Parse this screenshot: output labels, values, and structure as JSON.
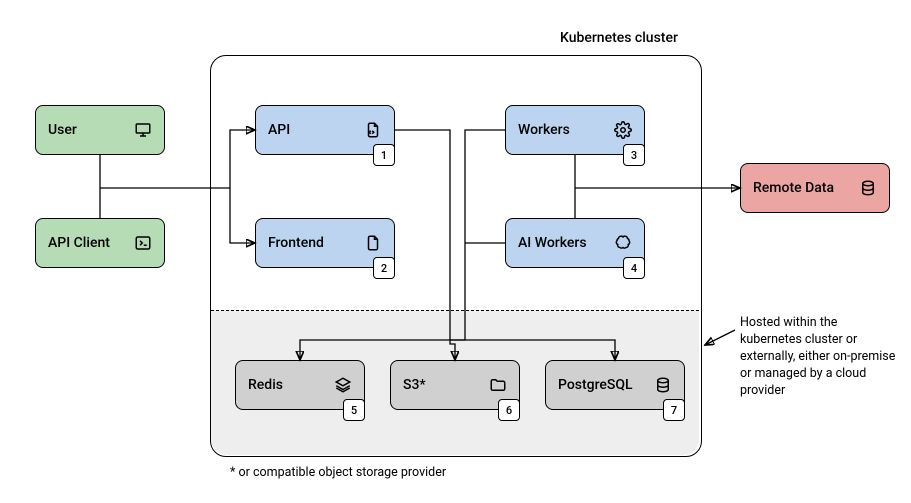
{
  "diagram": {
    "cluster_label": "Kubernetes cluster",
    "footnote": "* or compatible object storage provider",
    "annotation": "Hosted within the kubernetes cluster or externally, either on-premise or managed by a cloud provider",
    "nodes": {
      "user": {
        "label": "User",
        "badge": ""
      },
      "api_client": {
        "label": "API Client",
        "badge": ""
      },
      "api": {
        "label": "API",
        "badge": "1"
      },
      "frontend": {
        "label": "Frontend",
        "badge": "2"
      },
      "workers": {
        "label": "Workers",
        "badge": "3"
      },
      "ai_workers": {
        "label": "AI Workers",
        "badge": "4"
      },
      "redis": {
        "label": "Redis",
        "badge": "5"
      },
      "s3": {
        "label": "S3*",
        "badge": "6"
      },
      "postgres": {
        "label": "PostgreSQL",
        "badge": "7"
      },
      "remote": {
        "label": "Remote Data",
        "badge": ""
      }
    },
    "colors": {
      "green": "#b6dcb6",
      "blue": "#bcd4ef",
      "gray": "#d0d0d0",
      "red": "#eba6a4"
    }
  }
}
